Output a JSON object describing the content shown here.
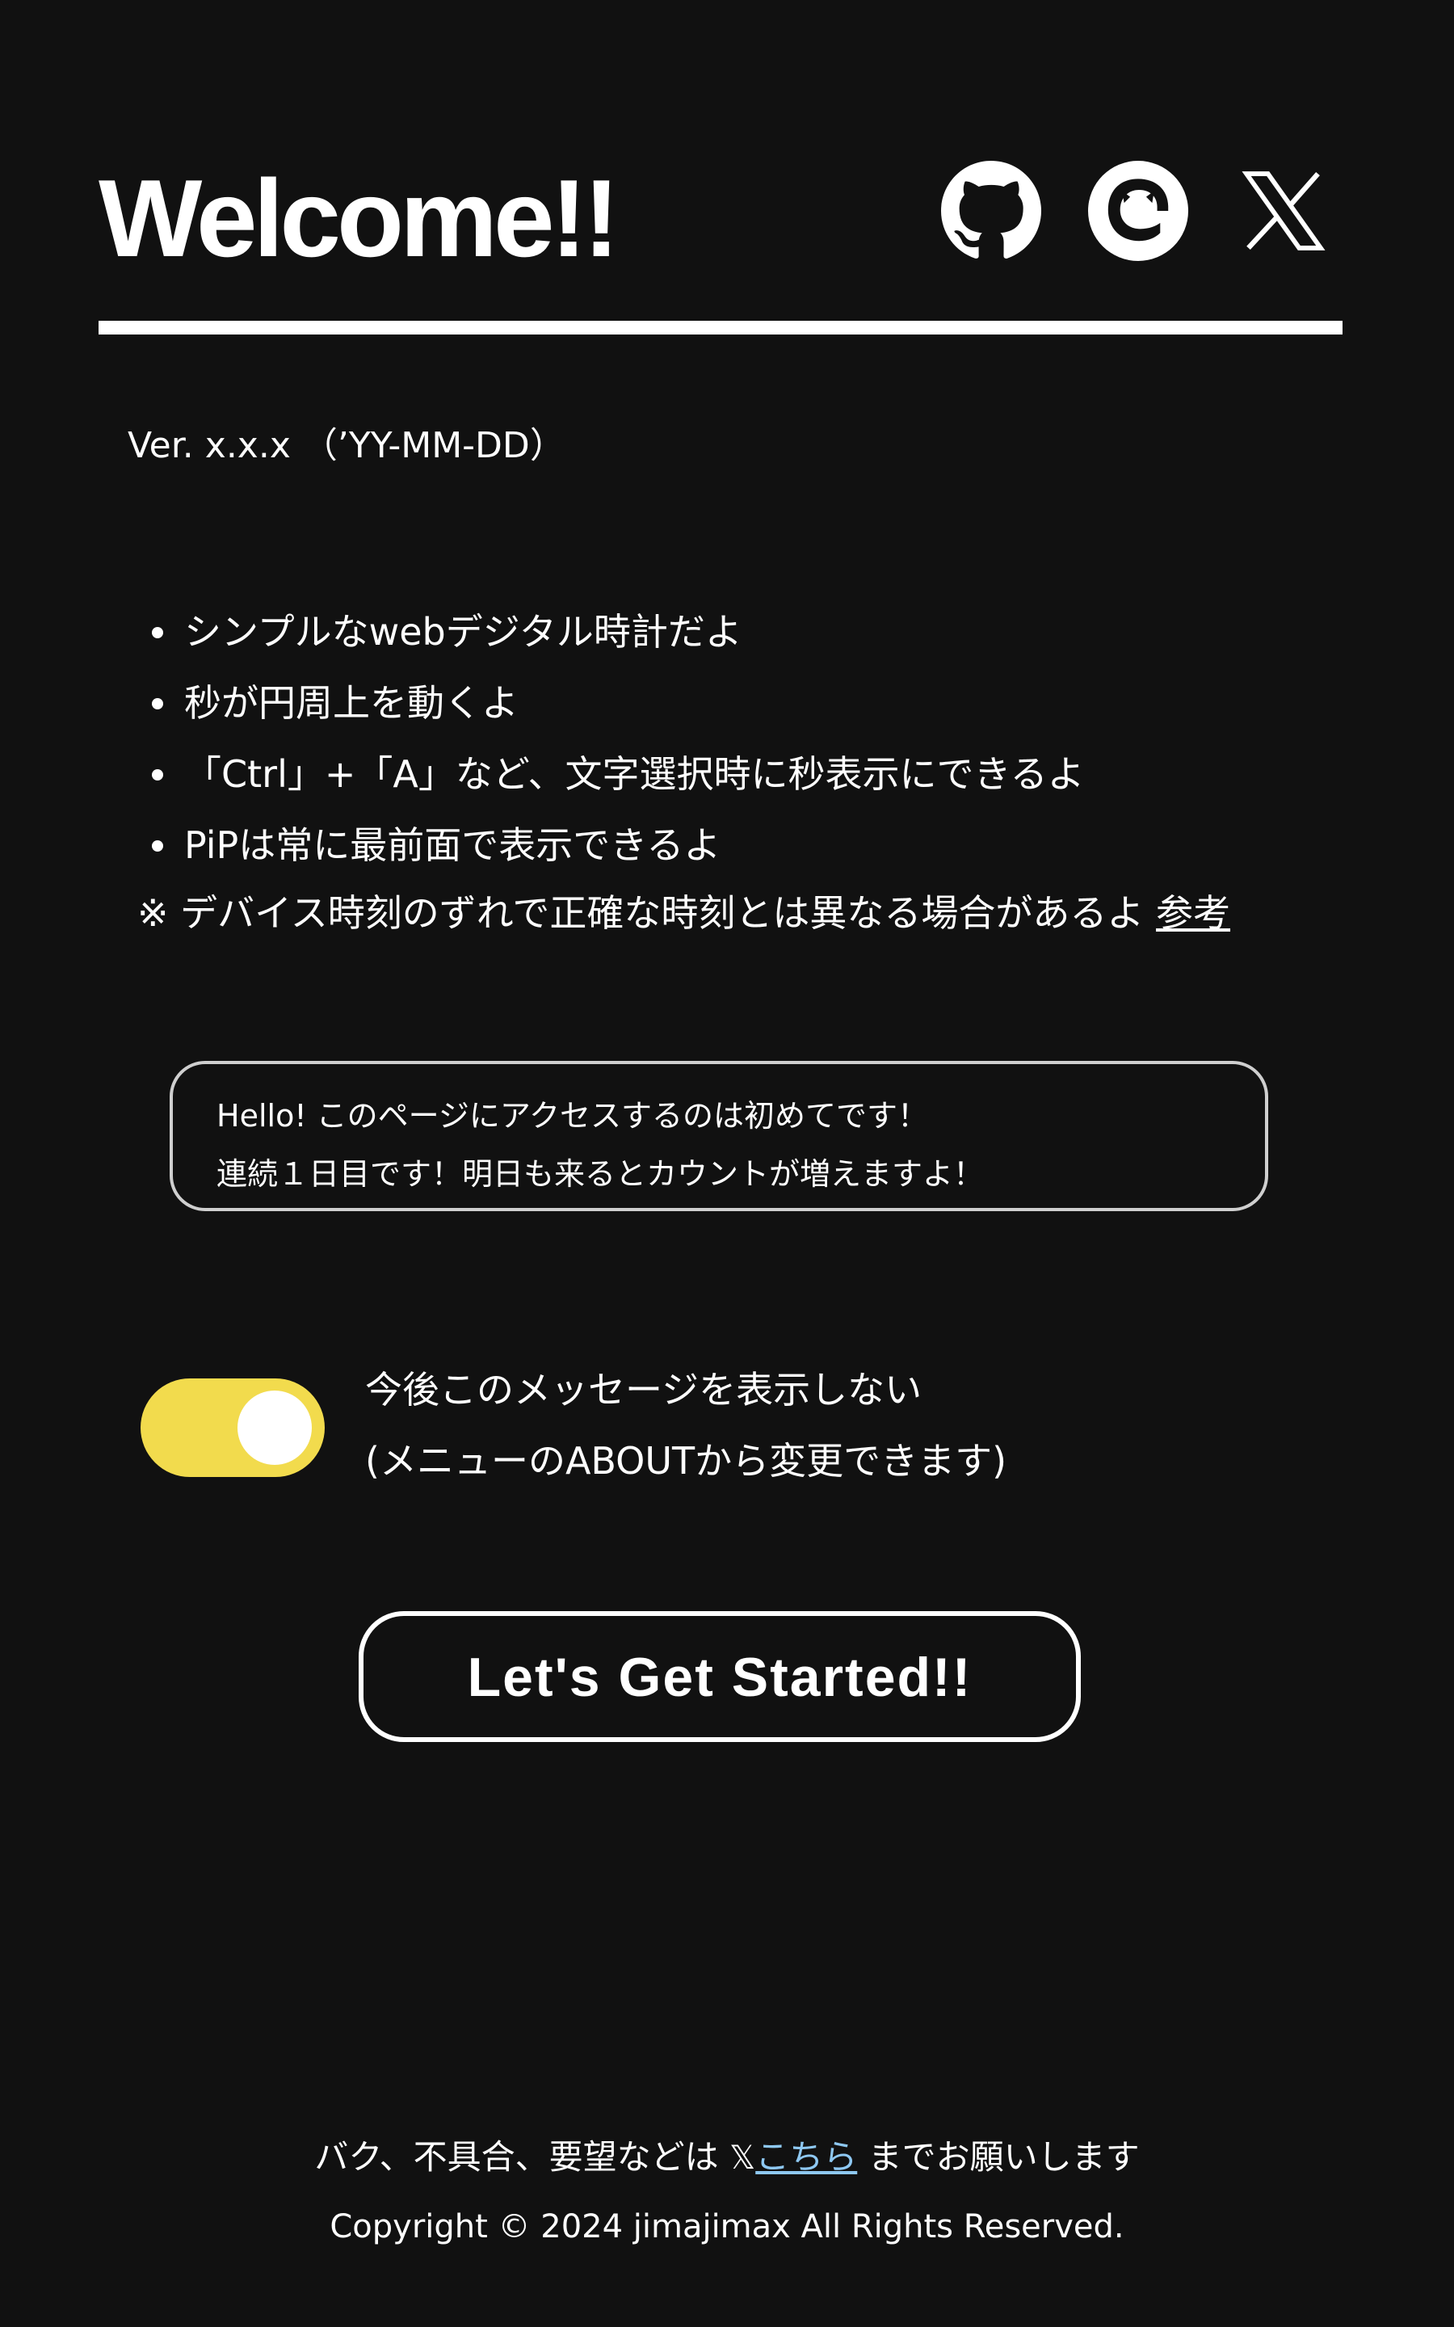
{
  "header": {
    "title": "Welcome!!",
    "social_icons": [
      "github-icon",
      "misskey-icon",
      "x-icon"
    ]
  },
  "version": "Ver. x.x.x （’YY-MM-DD）",
  "features": [
    "シンプルなwebデジタル時計だよ",
    "秒が円周上を動くよ",
    "「Ctrl」+「A」など、文字選択時に秒表示にできるよ",
    "PiPは常に最前面で表示できるよ"
  ],
  "note": {
    "text": "※ デバイス時刻のずれで正確な時刻とは異なる場合があるよ",
    "link_label": "参考"
  },
  "message": {
    "line1": "Hello! このページにアクセスするのは初めてです！",
    "line2": "連続１日目です！明日も来るとカウントが増えますよ！"
  },
  "toggle": {
    "checked": true,
    "label_line1": "今後このメッセージを表示しない",
    "label_line2": "(メニューのABOUTから変更できます)"
  },
  "start_button": {
    "label": "Let's Get Started!!"
  },
  "footer": {
    "contact_prefix": "バク、不具合、要望などは",
    "x_symbol": "𝕏",
    "contact_link": "こちら",
    "contact_suffix": "までお願いします",
    "copyright": "Copyright © 2024 jimajimax All Rights Reserved."
  },
  "colors": {
    "background": "#111111",
    "accent_toggle": "#f2db4d",
    "link": "#8ec8f2"
  }
}
